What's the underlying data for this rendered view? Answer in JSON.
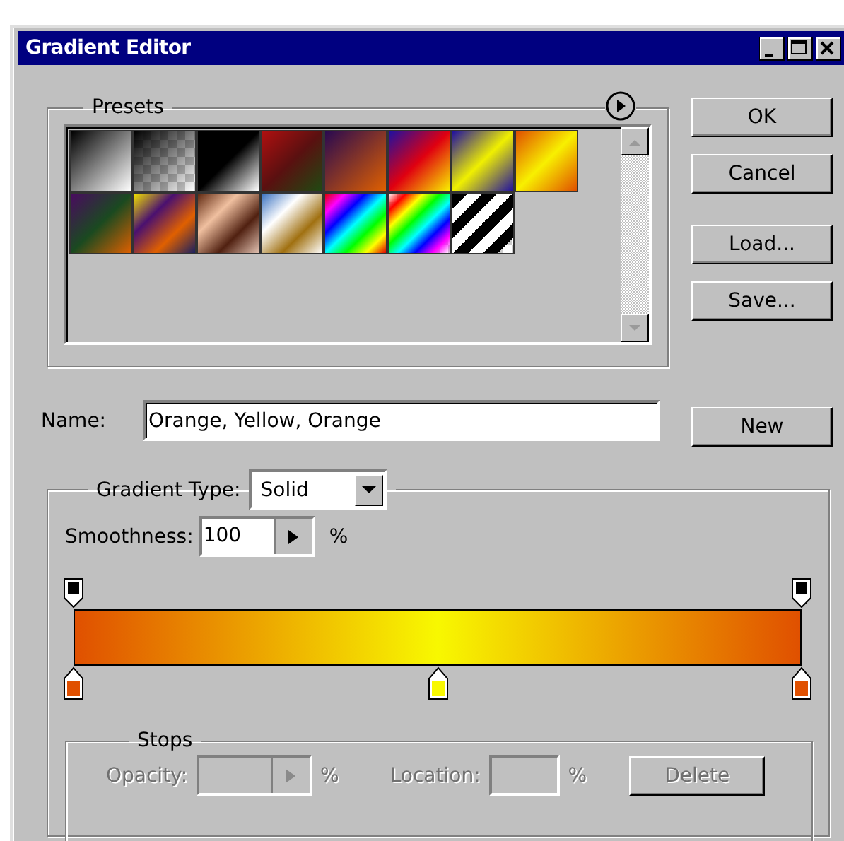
{
  "window": {
    "title": "Gradient Editor"
  },
  "presets": {
    "label": "Presets"
  },
  "buttons": [
    "OK",
    "Cancel",
    "Load...",
    "Save..."
  ],
  "name": {
    "label": "Name:",
    "value": "Orange, Yellow, Orange",
    "button": "New"
  },
  "gradient_type": {
    "label": "Gradient Type:",
    "value": "Solid"
  },
  "smoothness": {
    "label": "Smoothness:",
    "value": "100",
    "unit": "%"
  },
  "opacity_stops": [
    {
      "level": 0
    },
    {
      "level": 1
    }
  ],
  "color_stops": [
    {
      "level": 0,
      "color": "#e05000"
    },
    {
      "level": 0.5,
      "color": "#f8f800"
    },
    {
      "level": 1,
      "color": "#e05000"
    }
  ],
  "stops": {
    "label": "Stops",
    "opacity": {
      "label": "Opacity:",
      "unit": "%",
      "disabled": true
    },
    "location": {
      "label": "Location:",
      "unit": "%",
      "disabled": true
    },
    "delete": {
      "label": "Delete",
      "disabled": true
    }
  }
}
